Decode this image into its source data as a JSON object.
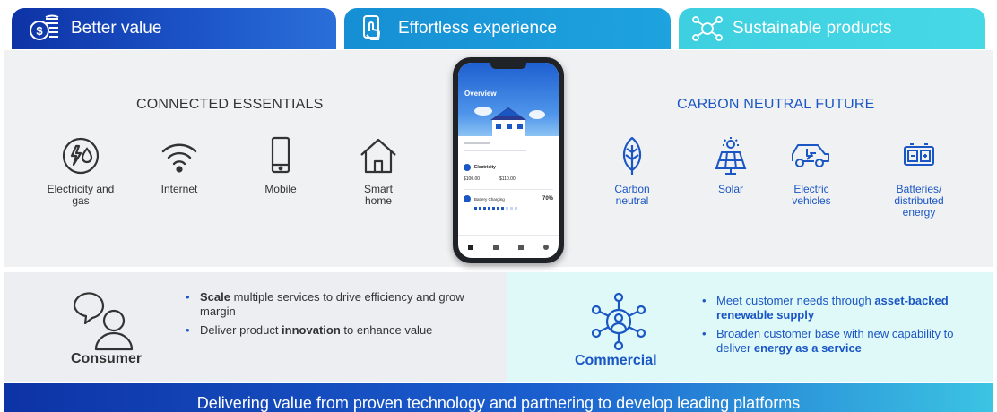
{
  "tabs": [
    {
      "label": "Better value",
      "icon": "coins-icon"
    },
    {
      "label": "Effortless experience",
      "icon": "tap-icon"
    },
    {
      "label": "Sustainable products",
      "icon": "network-icon"
    }
  ],
  "connected": {
    "title": "CONNECTED ESSENTIALS",
    "items": [
      {
        "label": "Electricity and gas",
        "icon": "electricity-gas-icon"
      },
      {
        "label": "Internet",
        "icon": "wifi-icon"
      },
      {
        "label": "Mobile",
        "icon": "mobile-icon"
      },
      {
        "label": "Smart home",
        "icon": "house-icon"
      }
    ]
  },
  "carbon": {
    "title": "CARBON NEUTRAL FUTURE",
    "items": [
      {
        "label": "Carbon neutral",
        "icon": "leaf-icon"
      },
      {
        "label": "Solar",
        "icon": "solar-panel-icon"
      },
      {
        "label": "Electric vehicles",
        "icon": "electric-car-icon"
      },
      {
        "label": "Batteries/ distributed energy",
        "icon": "battery-icon"
      }
    ]
  },
  "phone": {
    "screen_title": "Overview",
    "electricity_label": "Electricity",
    "amount_1": "$100.00",
    "amount_2": "$110.00",
    "battery_label": "Battery Charging",
    "battery_pct": "70%"
  },
  "consumer": {
    "label": "Consumer",
    "bullets": [
      {
        "bold": "Scale",
        "text": " multiple services to drive efficiency and grow margin"
      },
      {
        "pre": "Deliver product ",
        "bold": "innovation",
        "post": " to enhance value"
      }
    ]
  },
  "commercial": {
    "label": "Commercial",
    "bullets": [
      {
        "pre": "Meet customer needs through ",
        "bold": "asset-backed renewable supply"
      },
      {
        "pre": "Broaden customer base with new capability to deliver ",
        "bold": "energy as a service"
      }
    ]
  },
  "banner": {
    "text": "Delivering value from proven technology and partnering to develop leading platforms"
  },
  "colors": {
    "navy": "#0d33a6",
    "blue": "#1a56c4",
    "sky": "#1ea3df",
    "aqua": "#47d8e6"
  }
}
